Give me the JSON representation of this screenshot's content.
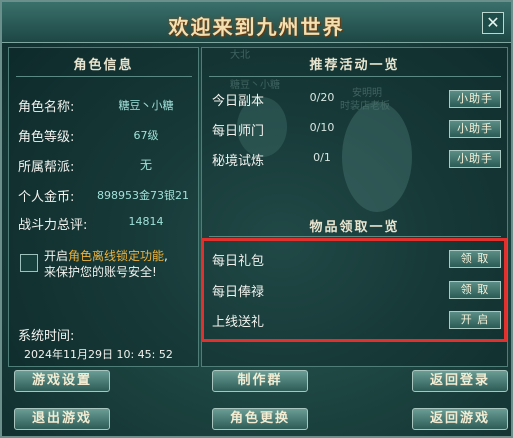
{
  "window": {
    "title": "欢迎来到九州世界",
    "close_glyph": "✕"
  },
  "left": {
    "section_title": "角色信息",
    "rows": [
      {
        "label": "角色名称:",
        "value": "糖豆丶小糖"
      },
      {
        "label": "角色等级:",
        "value": "67级"
      },
      {
        "label": "所属帮派:",
        "value": "无"
      },
      {
        "label": "个人金币:",
        "value": "898953金73银21"
      },
      {
        "label": "战斗力总评:",
        "value": "14814"
      }
    ],
    "lock": {
      "line1_prefix": "开启",
      "line1_highlight": "角色离线锁定功能",
      "line1_suffix": ",",
      "line2": "来保护您的账号安全!"
    },
    "system_time_label": "系统时间:",
    "system_time_value": "2024年11月29日 10: 45: 52"
  },
  "right": {
    "activities_title": "推荐活动一览",
    "activities": [
      {
        "label": "今日副本",
        "progress": "0/20",
        "button": "小助手"
      },
      {
        "label": "每日师门",
        "progress": "0/10",
        "button": "小助手"
      },
      {
        "label": "秘境试炼",
        "progress": "0/1",
        "button": "小助手"
      }
    ],
    "items_title": "物品领取一览",
    "items": [
      {
        "label": "每日礼包",
        "button": "领 取"
      },
      {
        "label": "每日俸禄",
        "button": "领 取"
      },
      {
        "label": "上线送礼",
        "button": "开 启"
      }
    ]
  },
  "background_text": [
    "大北",
    "糖豆丶小糖",
    "安明明",
    "时装店老板"
  ],
  "bottom_buttons": {
    "game_settings": "游戏设置",
    "production": "制作群",
    "return_login": "返回登录",
    "exit_game": "退出游戏",
    "change_character": "角色更换",
    "return_game": "返回游戏"
  }
}
